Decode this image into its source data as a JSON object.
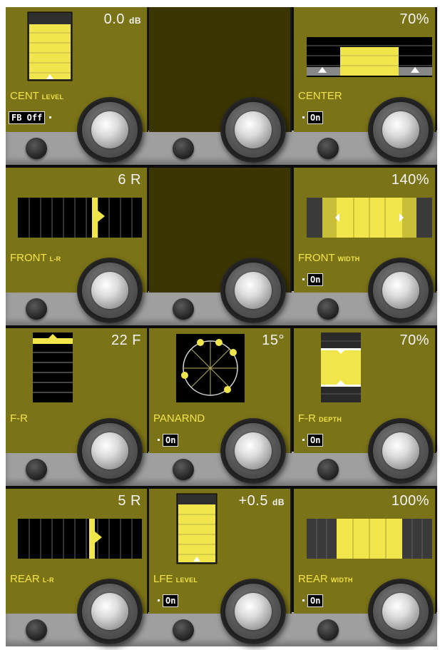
{
  "panel_name": "surround-panner",
  "colors": {
    "face": "#7b7318",
    "face_empty": "#3b3403",
    "accent": "#f4e34a",
    "text": "#f4f4f4",
    "rail": "#9f9f9f"
  },
  "rows": [
    {
      "cells": [
        {
          "type": "vertical-level",
          "readout": "0.0",
          "unit": "dB",
          "label": "CENT",
          "sublabel": "LEVEL",
          "toggle_prefix": "FB Off",
          "toggle": "",
          "level_fraction": 0.85
        },
        {
          "type": "empty"
        },
        {
          "type": "width-bar",
          "readout": "70%",
          "label": "CENTER",
          "sublabel": "",
          "toggle": "On",
          "width_fraction": 0.7
        }
      ]
    },
    {
      "cells": [
        {
          "type": "pan-lr",
          "readout": "6 R",
          "label": "FRONT",
          "sublabel": "L-R",
          "toggle": "",
          "pan_fraction": 0.62
        },
        {
          "type": "empty"
        },
        {
          "type": "width-bar-arrows",
          "readout": "140%",
          "label": "FRONT",
          "sublabel": "WIDTH",
          "toggle": "On",
          "width_fraction": 1.4
        }
      ]
    },
    {
      "cells": [
        {
          "type": "vertical-position",
          "readout": "22 F",
          "label": "F-R",
          "sublabel": "",
          "toggle": "",
          "position_fraction": 0.9
        },
        {
          "type": "panarnd",
          "readout": "15°",
          "label": "PANARND",
          "sublabel": "",
          "toggle": "On",
          "angle_deg": 15
        },
        {
          "type": "depth",
          "readout": "70%",
          "label": "F-R",
          "sublabel": "DEPTH",
          "toggle": "On",
          "depth_fraction": 0.7
        }
      ]
    },
    {
      "cells": [
        {
          "type": "pan-lr",
          "readout": "5 R",
          "label": "REAR",
          "sublabel": "L-R",
          "toggle": "",
          "pan_fraction": 0.6
        },
        {
          "type": "vertical-level",
          "readout": "+0.5",
          "unit": "dB",
          "label": "LFE",
          "sublabel": "LEVEL",
          "toggle_prefix": "",
          "toggle": "On",
          "level_fraction": 0.86
        },
        {
          "type": "width-bar",
          "readout": "100%",
          "label": "REAR",
          "sublabel": "WIDTH",
          "toggle": "On",
          "width_fraction": 1.0
        }
      ]
    }
  ]
}
